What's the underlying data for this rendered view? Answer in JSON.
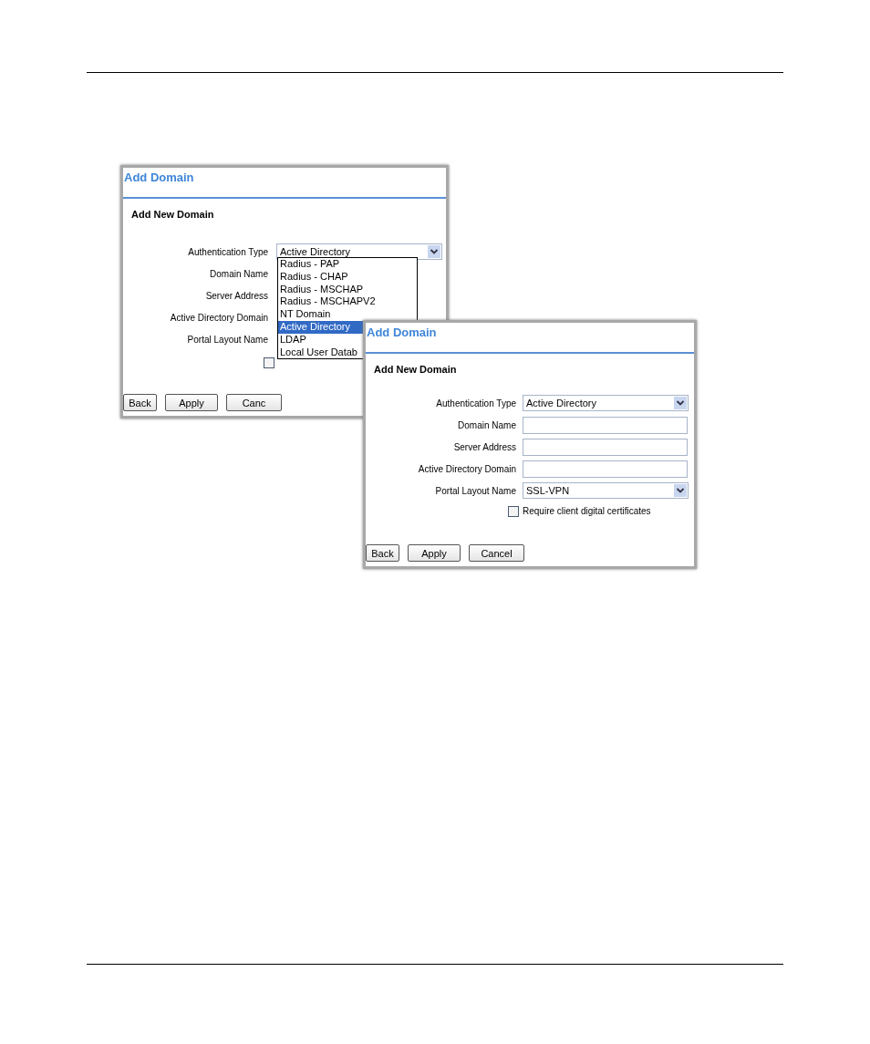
{
  "screen_1": {
    "title": "Add Domain",
    "heading": "Add New Domain",
    "select": {
      "label": "Authentication Type",
      "value": "Active Directory"
    },
    "labels": [
      "Domain Name",
      "Server Address",
      "Active Directory Domain",
      "Portal Layout Name"
    ],
    "options": [
      {
        "label": "Radius - PAP",
        "selected": false
      },
      {
        "label": "Radius - CHAP",
        "selected": false
      },
      {
        "label": "Radius - MSCHAP",
        "selected": false
      },
      {
        "label": "Radius - MSCHAPV2",
        "selected": false
      },
      {
        "label": "NT Domain",
        "selected": false
      },
      {
        "label": "Active Directory",
        "selected": true
      },
      {
        "label": "LDAP",
        "selected": false
      },
      {
        "label": "Local User Datab",
        "selected": false
      }
    ],
    "checkbox": {
      "checked": false
    },
    "buttons": [
      "Back",
      "Apply",
      "Canc"
    ]
  },
  "screen_2": {
    "title": "Add Domain",
    "heading": "Add New Domain",
    "fields": [
      {
        "label": "Authentication Type",
        "kind": "select",
        "value": "Active Directory"
      },
      {
        "label": "Domain Name",
        "kind": "text"
      },
      {
        "label": "Server Address",
        "kind": "text"
      },
      {
        "label": "Active Directory Domain",
        "kind": "text"
      },
      {
        "label": "Portal Layout Name",
        "kind": "select",
        "value": "SSL-VPN"
      }
    ],
    "checkbox": {
      "label": "Require client digital certificates",
      "checked": false
    },
    "buttons": [
      "Back",
      "Apply",
      "Cancel"
    ]
  }
}
